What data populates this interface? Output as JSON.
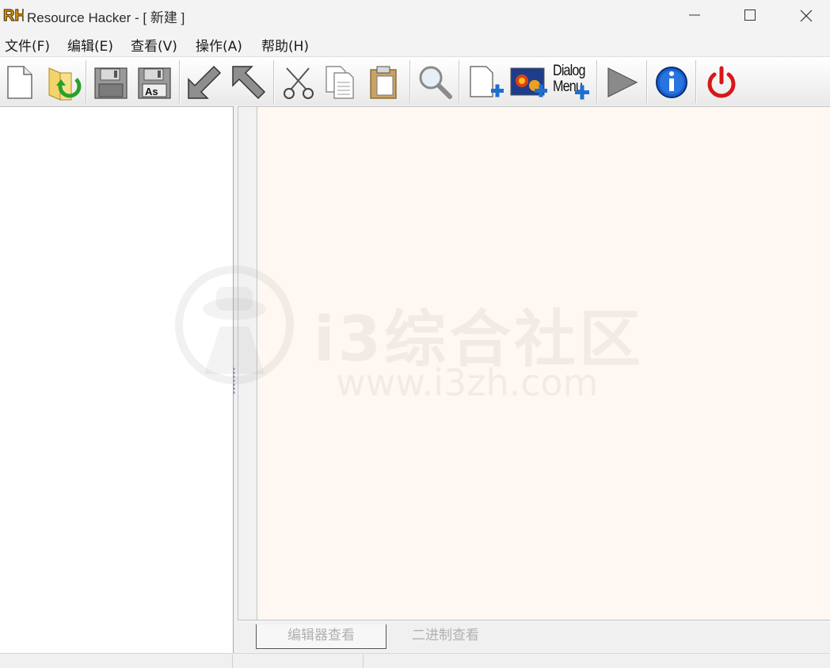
{
  "window": {
    "logo_text": "RH",
    "title": "Resource Hacker - [ 新建 ]",
    "accent_color": "#e8a317"
  },
  "menu": {
    "items": [
      "文件(F)",
      "编辑(E)",
      "查看(V)",
      "操作(A)",
      "帮助(H)"
    ]
  },
  "toolbar": {
    "dialog_line1": "Dialog",
    "dialog_line2": "Menu",
    "buttons": [
      "new-file-icon",
      "open-folder-icon",
      "save-floppy-icon",
      "save-as-icon",
      "compile-arrow-icon",
      "decompile-arrow-icon",
      "cut-scissors-icon",
      "copy-pages-icon",
      "paste-clipboard-icon",
      "search-magnifier-icon",
      "add-blank-resource-icon",
      "add-image-resource-icon",
      "add-dialog-menu-icon",
      "run-play-icon",
      "info-icon",
      "power-exit-icon"
    ]
  },
  "tabs": {
    "editor_view": "编辑器查看",
    "binary_view": "二进制查看"
  },
  "watermark": {
    "cn": "i3综合社区",
    "url": "www.i3zh.com"
  }
}
